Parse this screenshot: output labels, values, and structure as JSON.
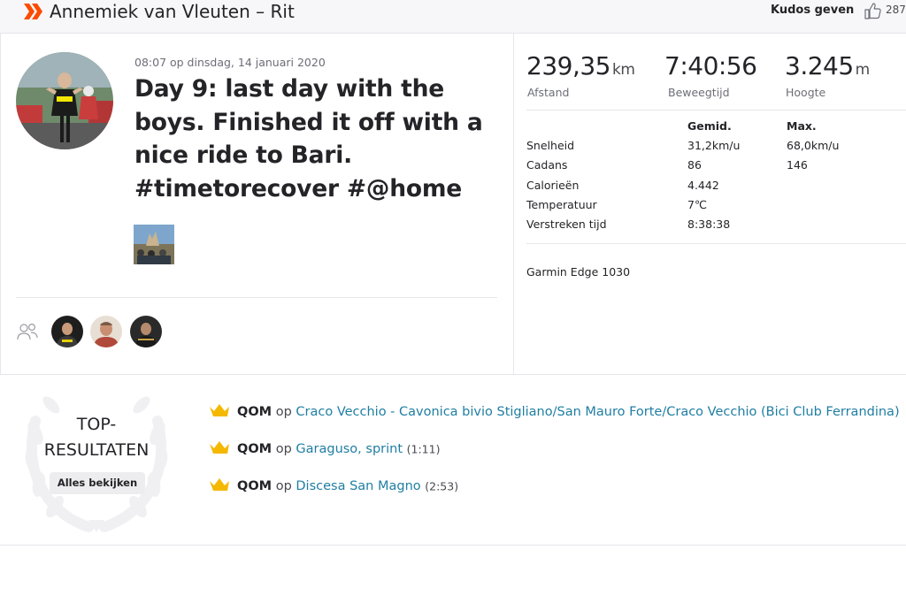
{
  "header": {
    "title": "Annemiek van Vleuten – Rit",
    "kudos_label": "Kudos geven",
    "kudos_count": "287"
  },
  "activity": {
    "date": "08:07 op dinsdag, 14 januari 2020",
    "title": "Day 9: last day with the boys. Finished it off with a nice ride to Bari. #timetorecover #@home"
  },
  "stats": {
    "distance": {
      "value": "239,35",
      "unit": "km",
      "label": "Afstand"
    },
    "moving_time": {
      "value": "7:40:56",
      "label": "Beweegtijd"
    },
    "elevation": {
      "value": "3.245",
      "unit": "m",
      "label": "Hoogte"
    },
    "col_avg": "Gemid.",
    "col_max": "Max.",
    "rows": [
      {
        "label": "Snelheid",
        "avg": "31,2km/u",
        "max": "68,0km/u"
      },
      {
        "label": "Cadans",
        "avg": "86",
        "max": "146"
      },
      {
        "label": "Calorieën",
        "avg": "4.442",
        "max": ""
      },
      {
        "label": "Temperatuur",
        "avg": "7℃",
        "max": ""
      },
      {
        "label": "Verstreken tijd",
        "avg": "8:38:38",
        "max": ""
      }
    ],
    "device": "Garmin Edge 1030"
  },
  "top_results": {
    "title": "TOP-RESULTATEN",
    "see_all": "Alles bekijken",
    "items": [
      {
        "badge": "QOM",
        "op": "op",
        "segment": "Craco Vecchio - Cavonica bivio Stigliano/San Mauro Forte/Craco Vecchio (Bici Club Ferrandina)",
        "time": ""
      },
      {
        "badge": "QOM",
        "op": "op",
        "segment": "Garaguso, sprint",
        "time": "(1:11)"
      },
      {
        "badge": "QOM",
        "op": "op",
        "segment": "Discesa San Magno",
        "time": "(2:53)"
      }
    ]
  },
  "colors": {
    "brand": "#fc4c02",
    "link": "#1f7ea3",
    "crown": "#f5b800"
  }
}
